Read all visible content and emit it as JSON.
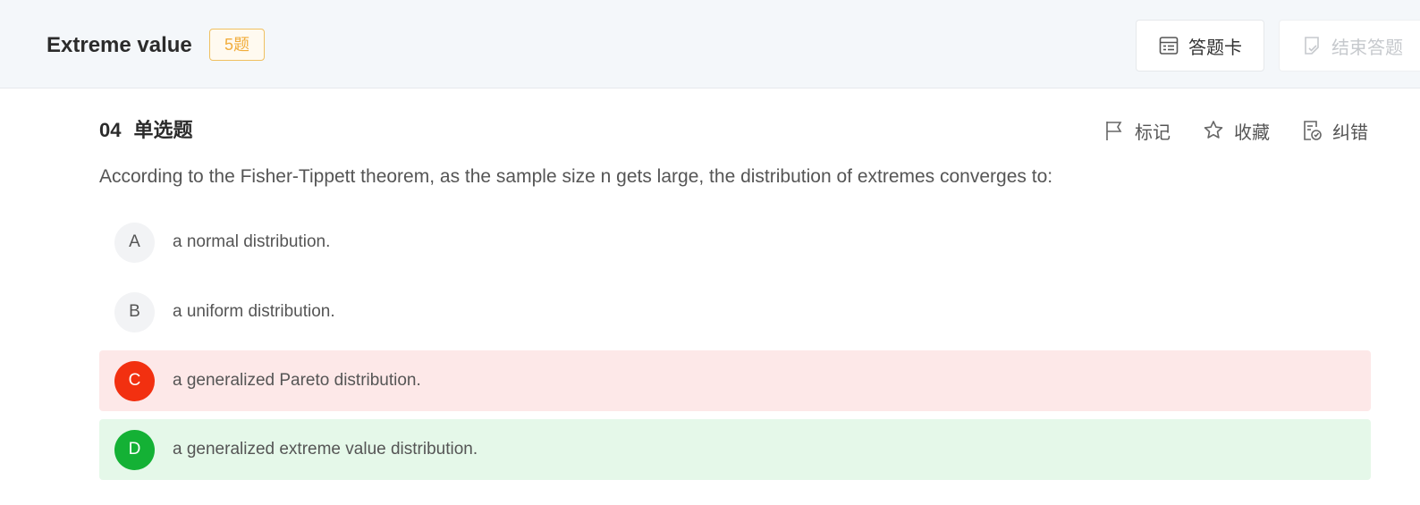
{
  "header": {
    "title": "Extreme value",
    "count_badge": "5题",
    "answer_card_label": "答题卡",
    "end_label": "结束答题",
    "icons": {
      "answer_card": "answer-sheet-icon",
      "end": "submit-document-icon"
    }
  },
  "question": {
    "number": "04",
    "type": "单选题",
    "text": "According to the Fisher-Tippett theorem, as the sample size n gets large, the distribution of extremes converges to:",
    "tools": {
      "mark_label": "标记",
      "favorite_label": "收藏",
      "report_label": "纠错"
    },
    "options": [
      {
        "letter": "A",
        "text": "a normal distribution.",
        "state": "default"
      },
      {
        "letter": "B",
        "text": "a uniform distribution.",
        "state": "default"
      },
      {
        "letter": "C",
        "text": "a generalized Pareto distribution.",
        "state": "wrong"
      },
      {
        "letter": "D",
        "text": "a generalized extreme value distribution.",
        "state": "correct"
      }
    ]
  },
  "colors": {
    "badge": "#f1ad3c",
    "wrong": "#f23010",
    "wrong_bg": "#fde8e8",
    "correct": "#14b135",
    "correct_bg": "#e5f8e9"
  }
}
